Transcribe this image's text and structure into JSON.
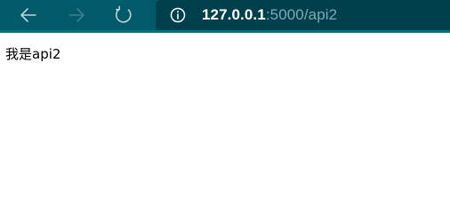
{
  "browser": {
    "toolbar": {
      "back_icon": "arrow-left-icon",
      "forward_icon": "arrow-right-icon",
      "refresh_icon": "refresh-icon",
      "info_icon": "info-circle-icon"
    },
    "address": {
      "host": "127.0.0.1",
      "rest": ":5000/api2"
    }
  },
  "page": {
    "body_text": "我是api2"
  },
  "colors": {
    "toolbar_bg": "#005a6a",
    "address_bg": "#003f4c",
    "address_host": "#ffffff",
    "address_rest": "#7fa9b3",
    "page_bg": "#ffffff"
  }
}
